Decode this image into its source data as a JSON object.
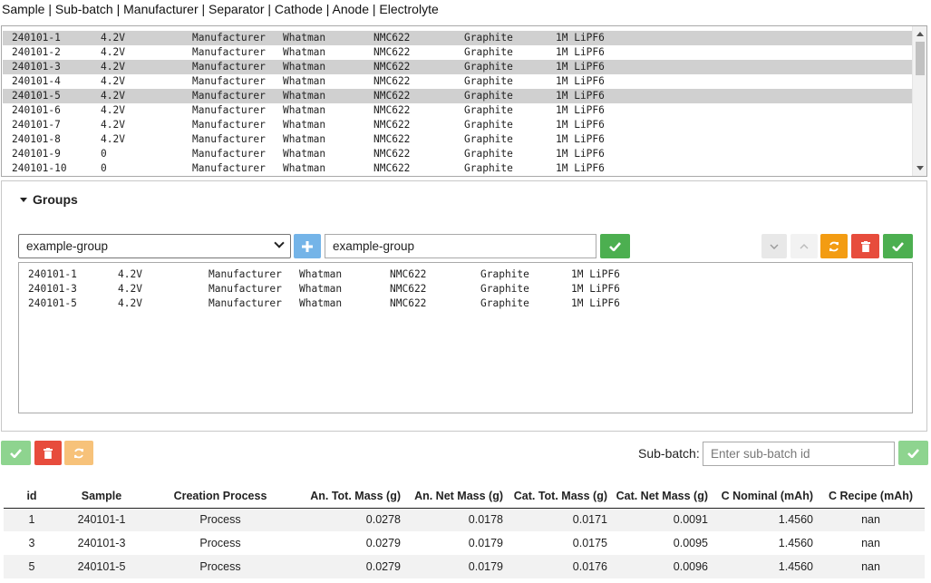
{
  "header": {
    "columns_line": "Sample | Sub-batch | Manufacturer | Separator | Cathode | Anode | Electrolyte"
  },
  "samples": [
    {
      "id": "240101-1",
      "v": "4.2V",
      "m": "Manufacturer",
      "s": "Whatman",
      "c": "NMC622",
      "a": "Graphite",
      "e": "1M LiPF6",
      "selected": true
    },
    {
      "id": "240101-2",
      "v": "4.2V",
      "m": "Manufacturer",
      "s": "Whatman",
      "c": "NMC622",
      "a": "Graphite",
      "e": "1M LiPF6",
      "selected": false
    },
    {
      "id": "240101-3",
      "v": "4.2V",
      "m": "Manufacturer",
      "s": "Whatman",
      "c": "NMC622",
      "a": "Graphite",
      "e": "1M LiPF6",
      "selected": true
    },
    {
      "id": "240101-4",
      "v": "4.2V",
      "m": "Manufacturer",
      "s": "Whatman",
      "c": "NMC622",
      "a": "Graphite",
      "e": "1M LiPF6",
      "selected": false
    },
    {
      "id": "240101-5",
      "v": "4.2V",
      "m": "Manufacturer",
      "s": "Whatman",
      "c": "NMC622",
      "a": "Graphite",
      "e": "1M LiPF6",
      "selected": true
    },
    {
      "id": "240101-6",
      "v": "4.2V",
      "m": "Manufacturer",
      "s": "Whatman",
      "c": "NMC622",
      "a": "Graphite",
      "e": "1M LiPF6",
      "selected": false
    },
    {
      "id": "240101-7",
      "v": "4.2V",
      "m": "Manufacturer",
      "s": "Whatman",
      "c": "NMC622",
      "a": "Graphite",
      "e": "1M LiPF6",
      "selected": false
    },
    {
      "id": "240101-8",
      "v": "4.2V",
      "m": "Manufacturer",
      "s": "Whatman",
      "c": "NMC622",
      "a": "Graphite",
      "e": "1M LiPF6",
      "selected": false
    },
    {
      "id": "240101-9",
      "v": "0",
      "m": "Manufacturer",
      "s": "Whatman",
      "c": "NMC622",
      "a": "Graphite",
      "e": "1M LiPF6",
      "selected": false
    },
    {
      "id": "240101-10",
      "v": "0",
      "m": "Manufacturer",
      "s": "Whatman",
      "c": "NMC622",
      "a": "Graphite",
      "e": "1M LiPF6",
      "selected": false
    }
  ],
  "groups": {
    "title": "Groups",
    "selected_group": "example-group",
    "name_value": "example-group",
    "icons": {
      "plus": "plus-icon",
      "rename": "check-icon",
      "down": "chevron-down-icon",
      "up": "chevron-up-icon",
      "refresh": "refresh-icon",
      "delete": "trash-icon",
      "save": "check-icon"
    },
    "members": [
      {
        "id": "240101-1",
        "v": "4.2V",
        "m": "Manufacturer",
        "s": "Whatman",
        "c": "NMC622",
        "a": "Graphite",
        "e": "1M LiPF6"
      },
      {
        "id": "240101-3",
        "v": "4.2V",
        "m": "Manufacturer",
        "s": "Whatman",
        "c": "NMC622",
        "a": "Graphite",
        "e": "1M LiPF6"
      },
      {
        "id": "240101-5",
        "v": "4.2V",
        "m": "Manufacturer",
        "s": "Whatman",
        "c": "NMC622",
        "a": "Graphite",
        "e": "1M LiPF6"
      }
    ]
  },
  "subbatch": {
    "label": "Sub-batch:",
    "placeholder": "Enter sub-batch id"
  },
  "colors": {
    "green": "#4caf50",
    "blue": "#74b4e8",
    "orange": "#f39c12",
    "red": "#e74c3c",
    "selected_row": "#d0d0d0"
  },
  "table": {
    "headers": [
      "id",
      "Sample",
      "Creation Process",
      "An. Tot. Mass (g)",
      "An. Net Mass (g)",
      "Cat. Tot. Mass (g)",
      "Cat. Net Mass (g)",
      "C Nominal (mAh)",
      "C Recipe (mAh)"
    ],
    "rows": [
      [
        "1",
        "240101-1",
        "Process",
        "0.0278",
        "0.0178",
        "0.0171",
        "0.0091",
        "1.4560",
        "nan"
      ],
      [
        "3",
        "240101-3",
        "Process",
        "0.0279",
        "0.0179",
        "0.0175",
        "0.0095",
        "1.4560",
        "nan"
      ],
      [
        "5",
        "240101-5",
        "Process",
        "0.0279",
        "0.0179",
        "0.0176",
        "0.0096",
        "1.4560",
        "nan"
      ]
    ]
  }
}
